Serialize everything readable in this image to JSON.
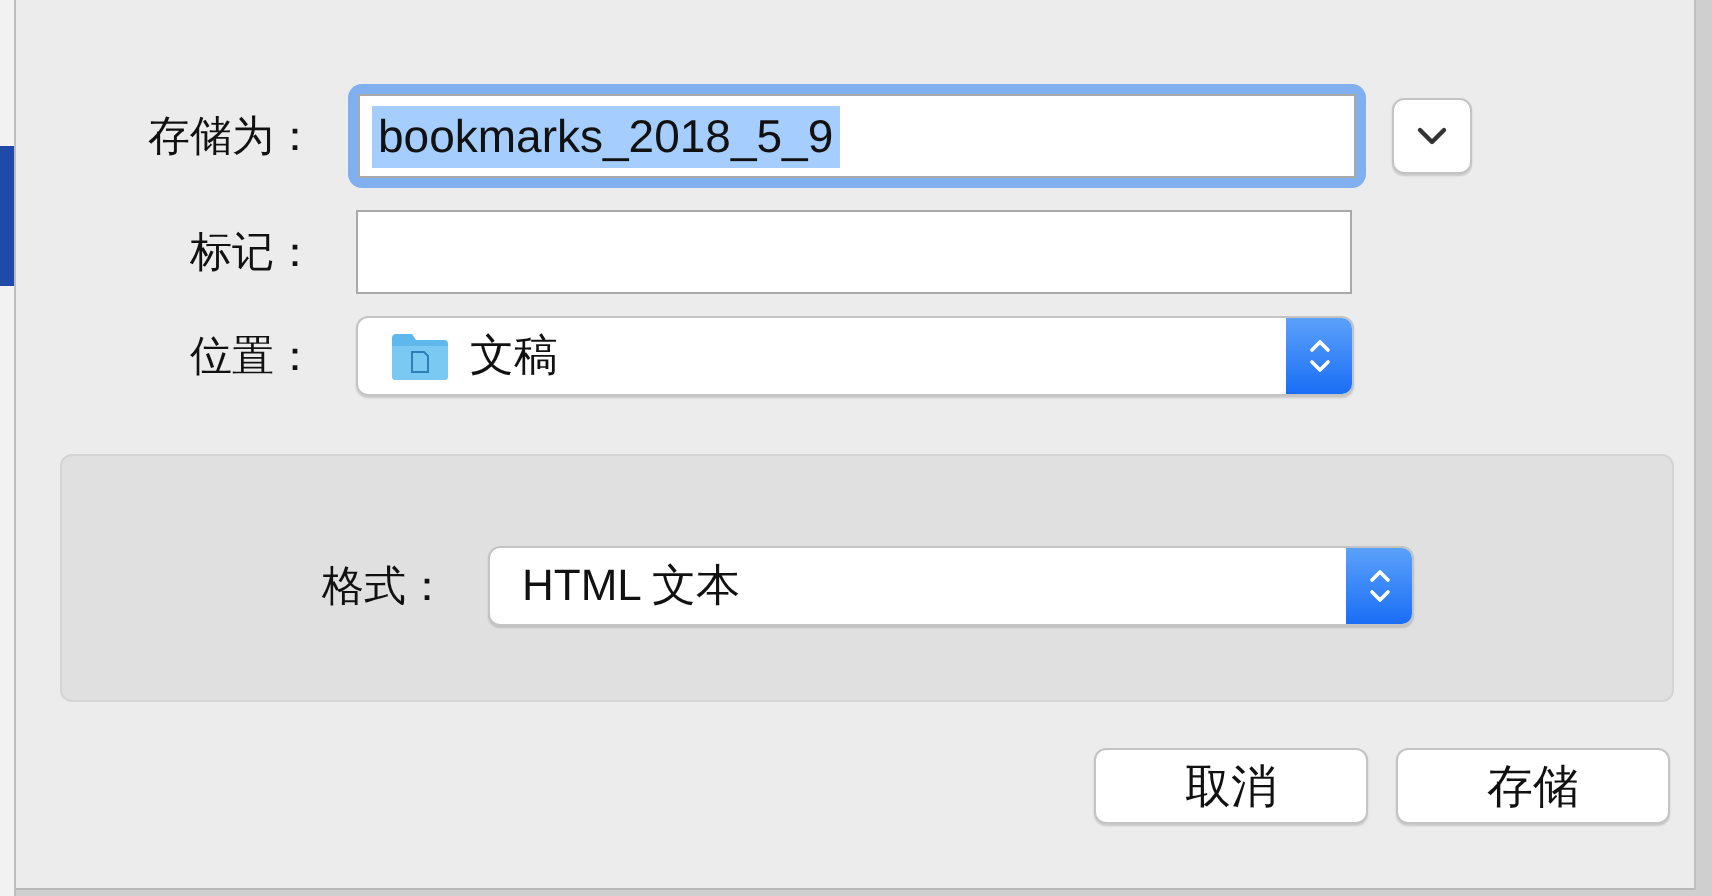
{
  "dialog": {
    "name_field": {
      "label": "存储为：",
      "value": "bookmarks_2018_5_9",
      "focused": true,
      "text_selected": true
    },
    "tags_field": {
      "label": "标记："
    },
    "location": {
      "label": "位置：",
      "value": "文稿"
    },
    "format": {
      "label": "格式：",
      "value": "HTML 文本"
    },
    "buttons": [
      {
        "label": "取消",
        "default": false
      },
      {
        "label": "存储",
        "default": false
      }
    ]
  }
}
